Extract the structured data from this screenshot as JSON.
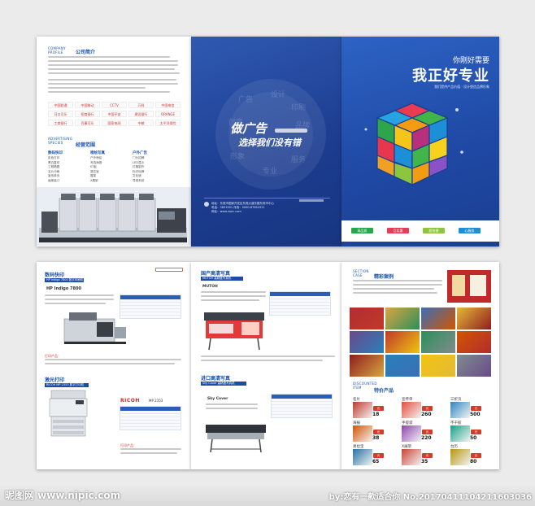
{
  "p1": {
    "company_en": "COMPANY PROFILE",
    "company_cn": "公司简介",
    "advertising_en": "ADVERTISING SPECIES",
    "advertising_cn": "经营范围",
    "scope_cols": [
      {
        "title": "数码快印",
        "items": [
          "彩色打印",
          "黑白复印",
          "工程晒图",
          "名片印刷",
          "宣传单页",
          "画册装订"
        ]
      },
      {
        "title": "喷绘写真",
        "items": [
          "户外喷绘",
          "写真海报",
          "KT板",
          "易拉宝",
          "展架",
          "X展架"
        ]
      },
      {
        "title": "户外广告",
        "items": [
          "门头招牌",
          "LED显示",
          "灯箱制作",
          "标识标牌",
          "文化墙",
          "导视系统"
        ]
      }
    ],
    "logos": [
      "中国联通",
      "中国移动",
      "CCTV",
      "万科",
      "中国电信",
      "可口可乐",
      "招商银行",
      "中国平安",
      "建设银行",
      "ORANGE",
      "工商银行",
      "百事可乐",
      "国家电网",
      "中粮",
      "太平洋保险"
    ]
  },
  "p2": {
    "slogan_main": "做广告",
    "slogan_sub": "选择我们没有错",
    "address": "地址：东莞市国家开发区东莞大道东路东莞市中心",
    "tel": "电话：3651901  传真：0000-87654321",
    "web": "网址：www.nipic.com"
  },
  "p3": {
    "headline_small": "你刚好需要",
    "headline_big": "我正好专业",
    "tagline": "我们提供产品价值 · 设计塑造品牌形象",
    "badges": [
      {
        "label": "高品质",
        "color": "#24a84a"
      },
      {
        "label": "巨实惠",
        "color": "#e83b57"
      },
      {
        "label": "超快捷",
        "color": "#8cc63e"
      },
      {
        "label": "心服务",
        "color": "#1c8fd6"
      }
    ]
  },
  "p4": {
    "sec1_title": "数码快印",
    "sec1_bar": "HP Indigo 7800 数字印刷机",
    "sec1_model": "HP Indigo 7800",
    "sec1_label": "打印产品：",
    "sec2_title": "激光打印",
    "sec2_bar": "RICOH MP 2353 数字打印机",
    "brand": "RICOH",
    "model_no": "MP 2353",
    "sec2_label": "打印产品："
  },
  "p5": {
    "sec1_title": "国产高清写真",
    "sec1_bar": "MUTOH 高精度写真机",
    "sec1_brand": "MUTOH",
    "sec2_title": "进口高清写真",
    "sec2_bar": "Sky Cover 高精度写真机",
    "sec2_brand": "Sky Cover"
  },
  "p6": {
    "section_en": "SECTION CASE",
    "section_cn": "精彩案例",
    "discount_en": "DISCOUNTED ITEM",
    "discount_cn": "特价产品",
    "products": [
      {
        "name": "名片",
        "price": "18",
        "unit": "元"
      },
      {
        "name": "宣传单",
        "price": "260",
        "unit": "元"
      },
      {
        "name": "三折页",
        "price": "500",
        "unit": "元"
      },
      {
        "name": "海报",
        "price": "38",
        "unit": "元"
      },
      {
        "name": "手提袋",
        "price": "220",
        "unit": "元"
      },
      {
        "name": "不干胶",
        "price": "50",
        "unit": "元"
      },
      {
        "name": "易拉宝",
        "price": "65",
        "unit": "元"
      },
      {
        "name": "X展架",
        "price": "35",
        "unit": "元"
      },
      {
        "name": "台历",
        "price": "80",
        "unit": "元"
      }
    ]
  },
  "watermark": {
    "left": "昵图网 www.nipic.com",
    "right": "by:恋有一款适合你  No.20170411104211603036"
  }
}
